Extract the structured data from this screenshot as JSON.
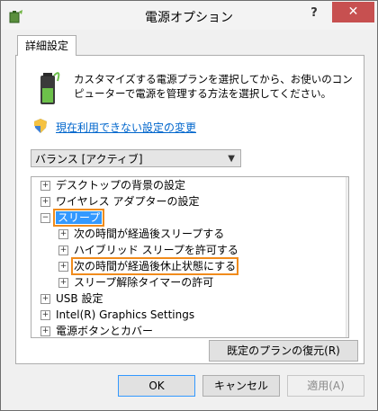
{
  "window": {
    "title": "電源オプション",
    "help": "?",
    "close": "✕"
  },
  "tab": {
    "label": "詳細設定"
  },
  "description": "カスタマイズする電源プランを選択してから、お使いのコンピューターで電源を管理する方法を選択してください。",
  "link": {
    "label": "現在利用できない設定の変更"
  },
  "plan_select": {
    "value": "バランス [アクティブ]"
  },
  "tree": {
    "items": [
      {
        "label": "デスクトップの背景の設定",
        "toggle": "+"
      },
      {
        "label": "ワイヤレス アダプターの設定",
        "toggle": "+"
      },
      {
        "label": "スリープ",
        "toggle": "−"
      },
      {
        "label": "次の時間が経過後スリープする",
        "toggle": "+"
      },
      {
        "label": "ハイブリッド スリープを許可する",
        "toggle": "+"
      },
      {
        "label": "次の時間が経過後休止状態にする",
        "toggle": "+"
      },
      {
        "label": "スリープ解除タイマーの許可",
        "toggle": "+"
      },
      {
        "label": "USB 設定",
        "toggle": "+"
      },
      {
        "label": "Intel(R) Graphics Settings",
        "toggle": "+"
      },
      {
        "label": "電源ボタンとカバー",
        "toggle": "+"
      }
    ]
  },
  "buttons": {
    "restore": "既定のプランの復元(R)",
    "ok": "OK",
    "cancel": "キャンセル",
    "apply": "適用(A)"
  },
  "colors": {
    "highlight": "#f08b1c",
    "selection": "#3399ff",
    "link": "#0066cc",
    "close": "#c75050"
  }
}
